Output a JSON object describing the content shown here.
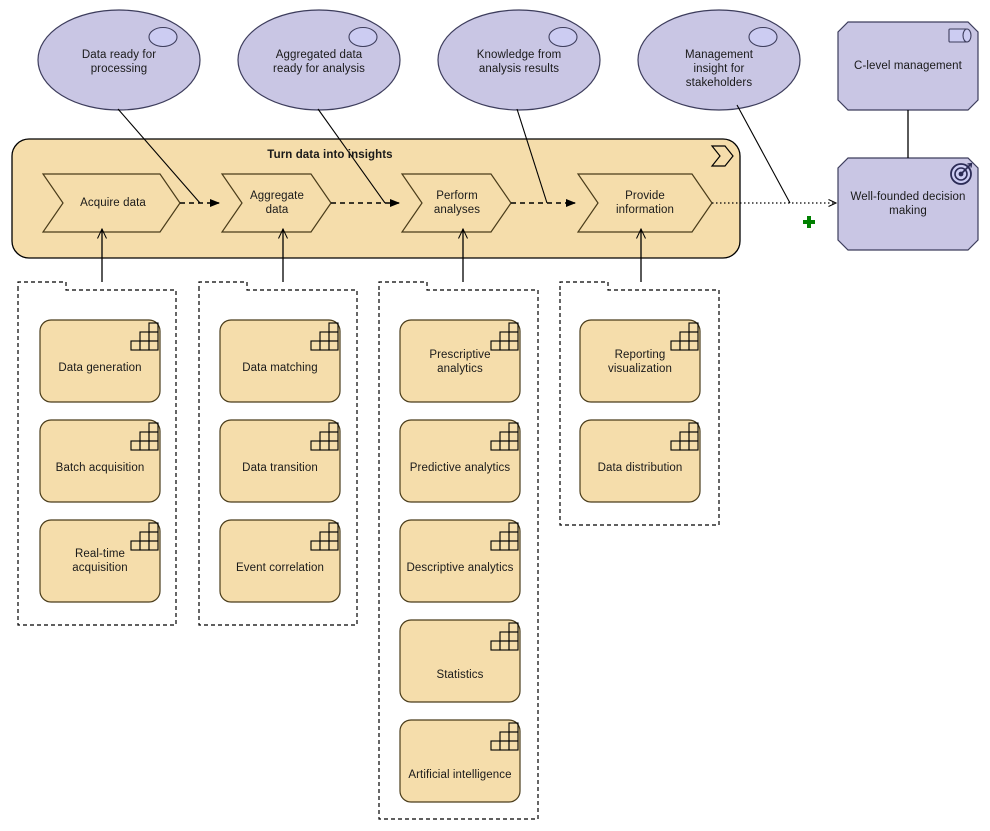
{
  "diagram": {
    "title": "Turn data into insights",
    "colors": {
      "business_fill": "#f5ddab",
      "business_stroke": "#4a3c1a",
      "motivation_fill": "#c9c6e4",
      "motivation_stroke": "#3d3d5c",
      "group_stroke": "#000000",
      "line": "#000000",
      "plus": "#008000"
    }
  },
  "outcomes": [
    {
      "id": "outcome-data-ready",
      "label": "Data ready for\nprocessing",
      "icon": "outcome-icon"
    },
    {
      "id": "outcome-aggregated",
      "label": "Aggregated data\nready for analysis",
      "icon": "outcome-icon"
    },
    {
      "id": "outcome-knowledge",
      "label": "Knowledge  from\nanalysis results",
      "icon": "outcome-icon"
    },
    {
      "id": "outcome-management-insight",
      "label": "Management\ninsight for\nstakeholders",
      "icon": "outcome-icon"
    }
  ],
  "stakeholder": {
    "label": "C-level management",
    "icon": "business-role-icon"
  },
  "goal": {
    "label": "Well-founded decision\nmaking",
    "icon": "goal-target-icon"
  },
  "junction": {
    "label": "+"
  },
  "process_band": {
    "title": "Turn data into insights",
    "icon": "process-chevron-icon",
    "steps": [
      {
        "id": "process-acquire-data",
        "label": "Acquire data"
      },
      {
        "id": "process-aggregate-data",
        "label": "Aggregate\ndata"
      },
      {
        "id": "process-perform-analyses",
        "label": "Perform\nanalyses"
      },
      {
        "id": "process-provide-information",
        "label": "Provide\ninformation"
      }
    ]
  },
  "capability_groups": [
    {
      "id": "group-acquire",
      "capabilities": [
        {
          "label": "Data generation",
          "icon": "capability-icon"
        },
        {
          "label": "Batch acquisition",
          "icon": "capability-icon"
        },
        {
          "label": "Real-time\nacquisition",
          "icon": "capability-icon"
        }
      ]
    },
    {
      "id": "group-aggregate",
      "capabilities": [
        {
          "label": "Data matching",
          "icon": "capability-icon"
        },
        {
          "label": "Data transition",
          "icon": "capability-icon"
        },
        {
          "label": "Event correlation",
          "icon": "capability-icon"
        }
      ]
    },
    {
      "id": "group-analyse",
      "capabilities": [
        {
          "label": "Prescriptive\nanalytics",
          "icon": "capability-icon"
        },
        {
          "label": "Predictive analytics",
          "icon": "capability-icon"
        },
        {
          "label": "Descriptive analytics",
          "icon": "capability-icon"
        },
        {
          "label": "Statistics",
          "icon": "capability-icon"
        },
        {
          "label": "Artificial intelligence",
          "icon": "capability-icon"
        }
      ]
    },
    {
      "id": "group-provide",
      "capabilities": [
        {
          "label": "Reporting\nvisualization",
          "icon": "capability-icon"
        },
        {
          "label": "Data distribution",
          "icon": "capability-icon"
        }
      ]
    }
  ]
}
